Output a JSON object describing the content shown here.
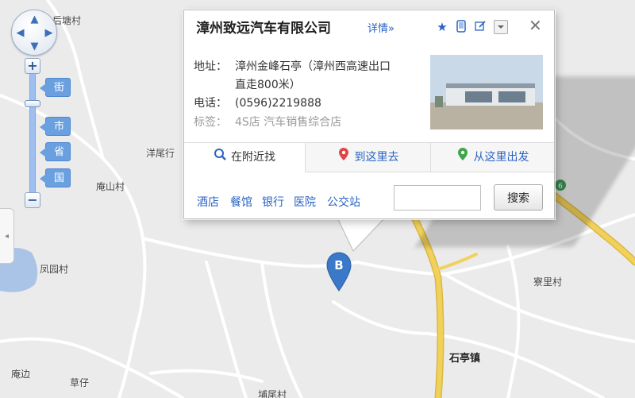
{
  "places": {
    "houtang": "后塘村",
    "yangwei": "洋尾行",
    "anshan": "庵山村",
    "fengyuan": "凤园村",
    "zhaili": "寮里村",
    "shiting": "石亭镇",
    "anbian": "庵边",
    "caozi": "草仔",
    "tanwei": "埔尾村"
  },
  "map_controls": {
    "zoom_in": "+",
    "zoom_out": "−",
    "levels": [
      "街",
      "市",
      "省",
      "国"
    ],
    "collapse": "◂"
  },
  "marker": {
    "label": "B"
  },
  "road_badge": "6",
  "popup": {
    "title": "漳州致远汽车有限公司",
    "detail_link": "详情»",
    "address_label": "地址：",
    "address_line1": "漳州金峰石亭（漳州西高速出口",
    "address_line2": "直走800米）",
    "phone_label": "电话：",
    "phone": "(0596)2219888",
    "tags_label": "标签：",
    "tags": "4S店 汽车销售综合店",
    "tabs": [
      "在附近找",
      "到这里去",
      "从这里出发"
    ],
    "quick_links": [
      "酒店",
      "餐馆",
      "银行",
      "医院",
      "公交站"
    ],
    "search_placeholder": "",
    "search_button": "搜索",
    "close": "✕",
    "icons": [
      "star-icon",
      "phone-icon",
      "edit-icon",
      "dropdown-icon"
    ]
  },
  "colors": {
    "link": "#2a63c4",
    "marker": "#3a78c8",
    "highway": "#f2d15a",
    "water": "#a9c4e6",
    "zoom_track": "#9ebff0"
  }
}
